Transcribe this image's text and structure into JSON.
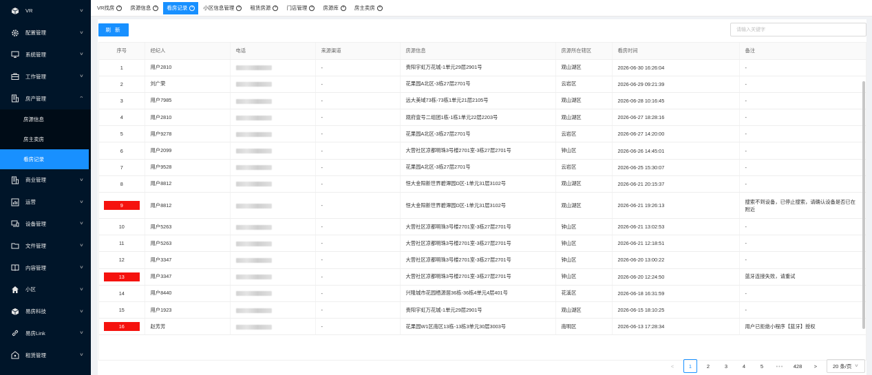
{
  "sidebar": {
    "items": [
      {
        "label": "VR",
        "icon": "cube-icon"
      },
      {
        "label": "配置管理",
        "icon": "gear-icon"
      },
      {
        "label": "系统管理",
        "icon": "monitor-icon"
      },
      {
        "label": "工作管理",
        "icon": "briefcase-icon"
      },
      {
        "label": "房产管理",
        "icon": "building-icon",
        "expanded": true
      },
      {
        "label": "商业管理",
        "icon": "building-icon"
      },
      {
        "label": "运营",
        "icon": "bar-chart-icon"
      },
      {
        "label": "设备管理",
        "icon": "device-icon"
      },
      {
        "label": "文件管理",
        "icon": "folder-icon"
      },
      {
        "label": "内容管理",
        "icon": "book-icon"
      },
      {
        "label": "小区",
        "icon": "home-icon"
      },
      {
        "label": "易房科技",
        "icon": "cube-icon"
      },
      {
        "label": "易房Link",
        "icon": "link-icon"
      },
      {
        "label": "租赁管理",
        "icon": "house-key-icon"
      }
    ],
    "submenu": [
      {
        "label": "房源信息"
      },
      {
        "label": "房主卖房"
      },
      {
        "label": "看房记录",
        "active": true
      }
    ]
  },
  "tabs": [
    {
      "label": "VR找房"
    },
    {
      "label": "房源信息"
    },
    {
      "label": "看房记录",
      "active": true
    },
    {
      "label": "小区信息管理"
    },
    {
      "label": "租赁房源"
    },
    {
      "label": "门店管理"
    },
    {
      "label": "房源库"
    },
    {
      "label": "房主卖房"
    }
  ],
  "toolbar": {
    "refresh_label": "刷 新",
    "search_placeholder": "请输入关键字"
  },
  "table": {
    "headers": {
      "index": "序号",
      "agent": "经纪人",
      "phone": "电话",
      "channel": "来源渠道",
      "house": "房源信息",
      "district": "房源所在辖区",
      "time": "看房时间",
      "note": "备注"
    },
    "rows": [
      {
        "index": "1",
        "agent": "用户2810",
        "channel": "-",
        "house": "贵阳宇虹万花城-1单元29层2901号",
        "district": "观山湖区",
        "time": "2026-06-30 16:26:04",
        "note": "-",
        "flag": false
      },
      {
        "index": "2",
        "agent": "刘广荣",
        "channel": "-",
        "house": "花果园A北区-3栋27层2701号",
        "district": "云岩区",
        "time": "2026-06-29 09:21:39",
        "note": "-",
        "flag": false
      },
      {
        "index": "3",
        "agent": "用户7985",
        "channel": "-",
        "house": "远大美域73栋-73栋1单元21层2105号",
        "district": "观山湖区",
        "time": "2026-06-28 10:16:45",
        "note": "-",
        "flag": false
      },
      {
        "index": "4",
        "agent": "用户2810",
        "channel": "-",
        "house": "观府壹号二组团1栋-1栋1单元22层2203号",
        "district": "观山湖区",
        "time": "2026-06-27 18:28:16",
        "note": "-",
        "flag": false
      },
      {
        "index": "5",
        "agent": "用户9278",
        "channel": "-",
        "house": "花果园A北区-3栋27层2701号",
        "district": "云岩区",
        "time": "2026-06-27 14:20:00",
        "note": "-",
        "flag": false
      },
      {
        "index": "6",
        "agent": "用户2099",
        "channel": "-",
        "house": "大营社区凉都明珠3号楼2701室-3栋27层2701号",
        "district": "钟山区",
        "time": "2026-06-26 14:45:01",
        "note": "-",
        "flag": false
      },
      {
        "index": "7",
        "agent": "用户9528",
        "channel": "-",
        "house": "花果园A北区-3栋27层2701号",
        "district": "云岩区",
        "time": "2026-06-25 15:30:07",
        "note": "-",
        "flag": false
      },
      {
        "index": "8",
        "agent": "用户8812",
        "channel": "-",
        "house": "恒大金阳新世界碧潭园D区-1单元31层3102号",
        "district": "观山湖区",
        "time": "2026-06-21 20:15:37",
        "note": "-",
        "flag": false
      },
      {
        "index": "9",
        "agent": "用户8812",
        "channel": "-",
        "house": "恒大金阳新世界碧潭园D区-1单元31层3102号",
        "district": "观山湖区",
        "time": "2026-06-21 19:26:13",
        "note": "搜索不到设备，已停止搜索，请确认设备是否已在附近",
        "flag": true,
        "tall": true
      },
      {
        "index": "10",
        "agent": "用户5263",
        "channel": "-",
        "house": "大营社区凉都明珠3号楼2701室-3栋27层2701号",
        "district": "钟山区",
        "time": "2026-06-21 13:02:53",
        "note": "-",
        "flag": false
      },
      {
        "index": "11",
        "agent": "用户5263",
        "channel": "-",
        "house": "大营社区凉都明珠3号楼2701室-3栋27层2701号",
        "district": "钟山区",
        "time": "2026-06-21 12:18:51",
        "note": "-",
        "flag": false
      },
      {
        "index": "12",
        "agent": "用户3347",
        "channel": "-",
        "house": "大营社区凉都明珠3号楼2701室-3栋27层2701号",
        "district": "钟山区",
        "time": "2026-06-20 13:00:22",
        "note": "-",
        "flag": false
      },
      {
        "index": "13",
        "agent": "用户3347",
        "channel": "-",
        "house": "大营社区凉都明珠3号楼2701室-3栋27层2701号",
        "district": "钟山区",
        "time": "2026-06-20 12:24:50",
        "note": "蓝牙连接失败，请重试",
        "flag": true
      },
      {
        "index": "14",
        "agent": "用户8440",
        "channel": "-",
        "house": "兴隆城市花园栖源居36栋-36栋4单元4层401号",
        "district": "花溪区",
        "time": "2026-06-18 16:31:59",
        "note": "-",
        "flag": false
      },
      {
        "index": "15",
        "agent": "用户1923",
        "channel": "-",
        "house": "贵阳宇虹万花城-1单元29层2901号",
        "district": "观山湖区",
        "time": "2026-06-15 18:10:25",
        "note": "-",
        "flag": false
      },
      {
        "index": "16",
        "agent": "赵芳芳",
        "channel": "-",
        "house": "花果园W1区南区13栋-13栋3单元30层3003号",
        "district": "南明区",
        "time": "2026-06-13 17:28:34",
        "note": "用户已拒绝小程序【蓝牙】授权",
        "flag": true
      }
    ]
  },
  "pagination": {
    "prev": "<",
    "pages": [
      "1",
      "2",
      "3",
      "4",
      "5"
    ],
    "current": "1",
    "ellipsis": "•••",
    "last": "428",
    "next": ">",
    "page_size": "20 条/页"
  },
  "colors": {
    "sidebar_bg": "#001529",
    "accent": "#1890ff",
    "flag_red": "#f5120e"
  }
}
